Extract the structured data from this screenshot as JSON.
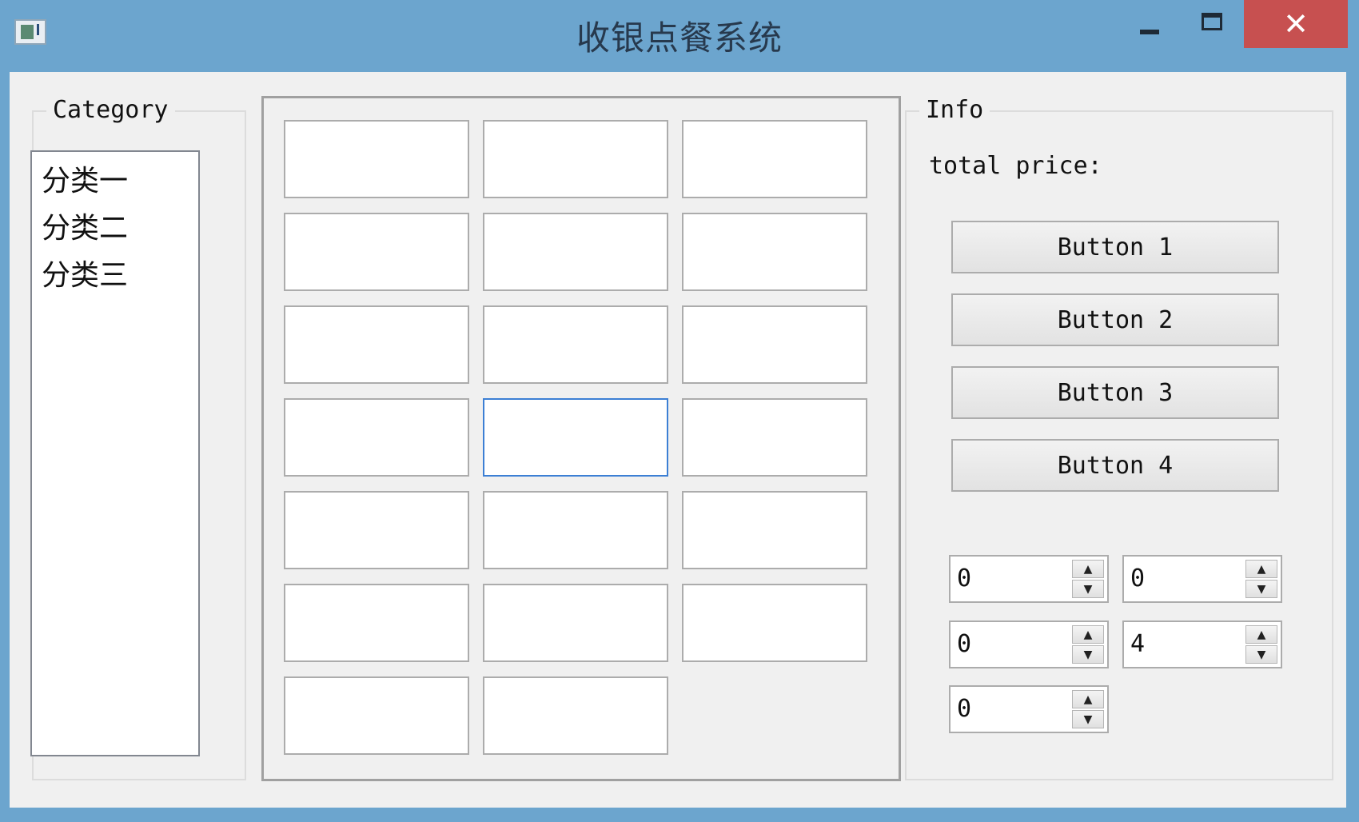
{
  "window": {
    "title": "收银点餐系统",
    "close_label": "✕"
  },
  "category": {
    "title": "Category",
    "items": [
      "分类一",
      "分类二",
      "分类三"
    ]
  },
  "info": {
    "title": "Info",
    "total_label": "total price:",
    "buttons": [
      "Button 1",
      "Button 2",
      "Button 3",
      "Button 4"
    ],
    "spinboxes": [
      "0",
      "0",
      "0",
      "4",
      "0"
    ]
  }
}
